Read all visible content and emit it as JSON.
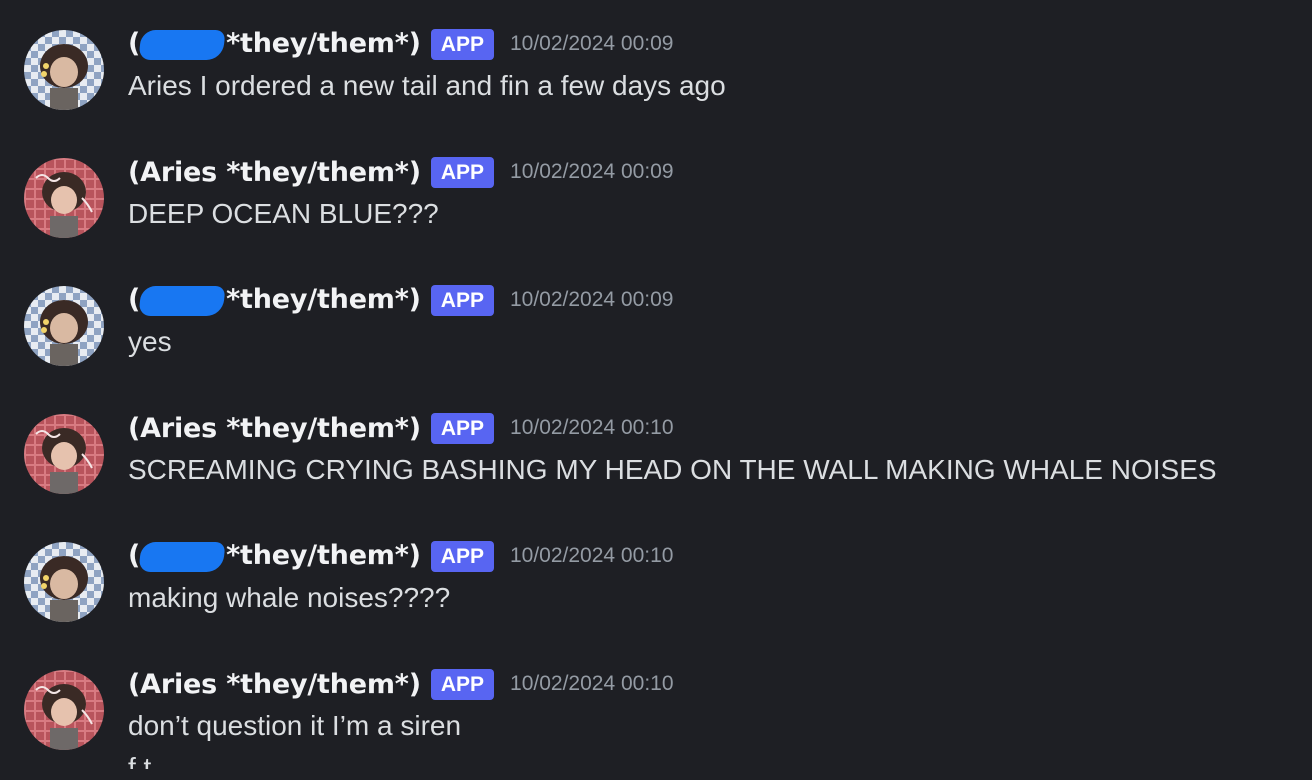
{
  "messages": [
    {
      "author_prefix": "(",
      "author_suffix": "*they/them*)",
      "redacted": true,
      "badge": "APP",
      "timestamp": "10/02/2024 00:09",
      "text": "Aries I ordered a new tail and fin a few days ago",
      "avatar": "checkered-avatar"
    },
    {
      "author": "(Aries *they/them*)",
      "redacted": false,
      "badge": "APP",
      "timestamp": "10/02/2024 00:09",
      "text": "DEEP OCEAN BLUE???",
      "avatar": "red-plaid-avatar"
    },
    {
      "author_prefix": "(",
      "author_suffix": "*they/them*)",
      "redacted": true,
      "badge": "APP",
      "timestamp": "10/02/2024 00:09",
      "text": "yes",
      "avatar": "checkered-avatar"
    },
    {
      "author": "(Aries *they/them*)",
      "redacted": false,
      "badge": "APP",
      "timestamp": "10/02/2024 00:10",
      "text": "SCREAMING CRYING BASHING MY HEAD ON THE WALL MAKING WHALE NOISES",
      "avatar": "red-plaid-avatar"
    },
    {
      "author_prefix": "(",
      "author_suffix": "*they/them*)",
      "redacted": true,
      "badge": "APP",
      "timestamp": "10/02/2024 00:10",
      "text": "making whale noises????",
      "avatar": "checkered-avatar"
    },
    {
      "author": "(Aries *they/them*)",
      "redacted": false,
      "badge": "APP",
      "timestamp": "10/02/2024 00:10",
      "text": "don’t question it I’m a siren",
      "avatar": "red-plaid-avatar"
    }
  ],
  "partial_next_line": "f t",
  "colors": {
    "background": "#1e1f24",
    "badge": "#5865f2",
    "redaction": "#1877f2",
    "timestamp": "#949ba4"
  }
}
